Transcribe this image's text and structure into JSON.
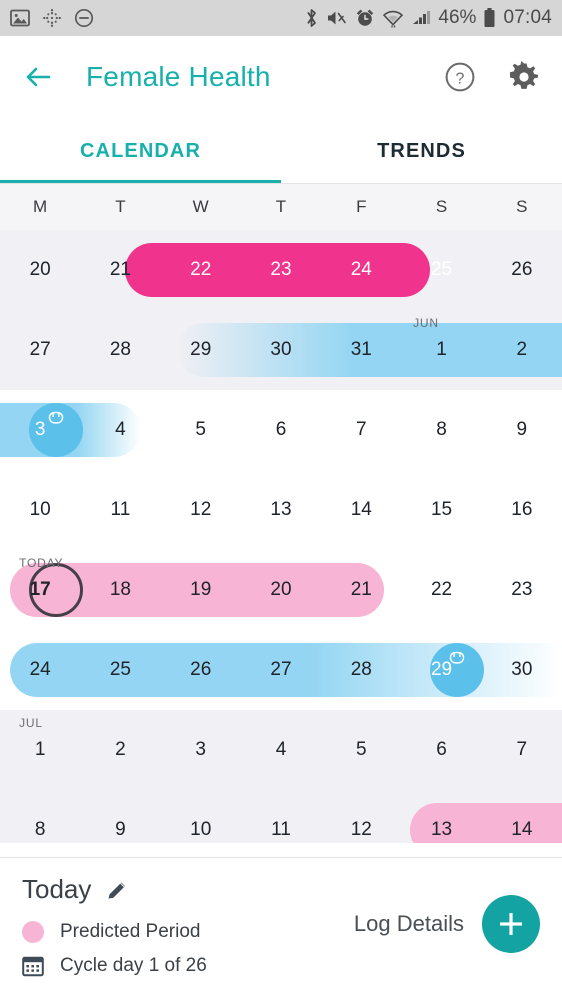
{
  "status_bar": {
    "left_icons": [
      "image-icon",
      "dots-move-icon",
      "do-not-disturb-icon"
    ],
    "right_icons": [
      "bluetooth-icon",
      "vibrate-icon",
      "alarm-icon",
      "wifi-icon",
      "signal-icon",
      "battery-icon"
    ],
    "battery_percent": "46%",
    "time": "07:04"
  },
  "app_bar": {
    "back_icon": "back-arrow-icon",
    "title": "Female Health",
    "help_icon": "help-icon",
    "settings_icon": "gear-icon"
  },
  "tabs": [
    {
      "label": "CALENDAR",
      "active": true
    },
    {
      "label": "TRENDS",
      "active": false
    }
  ],
  "weekdays": [
    "M",
    "T",
    "W",
    "T",
    "F",
    "S",
    "S"
  ],
  "calendar": {
    "weeks": [
      {
        "shade": "gray",
        "days": [
          "20",
          "21",
          "22",
          "23",
          "24",
          "25",
          "26"
        ],
        "month_label": null
      },
      {
        "shade": "gray",
        "days": [
          "27",
          "28",
          "29",
          "30",
          "31",
          "1",
          "2"
        ],
        "month_label": {
          "text": "JUN",
          "col": 5
        }
      },
      {
        "shade": "white",
        "days": [
          "3",
          "4",
          "5",
          "6",
          "7",
          "8",
          "9"
        ],
        "month_label": null
      },
      {
        "shade": "white",
        "days": [
          "10",
          "11",
          "12",
          "13",
          "14",
          "15",
          "16"
        ],
        "month_label": null
      },
      {
        "shade": "white",
        "days": [
          "17",
          "18",
          "19",
          "20",
          "21",
          "22",
          "23"
        ],
        "month_label": {
          "text": "TODAY",
          "col": 0
        }
      },
      {
        "shade": "white",
        "days": [
          "24",
          "25",
          "26",
          "27",
          "28",
          "29",
          "30"
        ],
        "month_label": null
      },
      {
        "shade": "gray",
        "days": [
          "1",
          "2",
          "3",
          "4",
          "5",
          "6",
          "7"
        ],
        "month_label": {
          "text": "JUL",
          "col": 0
        }
      },
      {
        "shade": "gray",
        "days": [
          "8",
          "9",
          "10",
          "11",
          "12",
          "13",
          "14"
        ],
        "month_label": null
      }
    ],
    "today": {
      "week": 4,
      "col": 0,
      "day": "17"
    },
    "ovulation_days": [
      {
        "week": 2,
        "col": 0,
        "day": "3"
      },
      {
        "week": 5,
        "col": 5,
        "day": "29"
      }
    ]
  },
  "bottom_panel": {
    "today_label": "Today",
    "edit_icon": "pencil-icon",
    "legend": [
      {
        "icon": "pink-dot-icon",
        "label": "Predicted Period"
      },
      {
        "icon": "calendar-icon",
        "label": "Cycle day 1 of 26"
      }
    ],
    "log_details_label": "Log Details",
    "add_icon": "plus-icon"
  },
  "colors": {
    "accent_teal": "#17b0ab",
    "period_pink": "#f0338c",
    "predicted_pink": "#f8b4d4",
    "fertile_blue": "#93d5f2",
    "ovulation_blue": "#5bc0ea",
    "fab_teal": "#14a3a3",
    "row_shade": "#f1f0f4"
  }
}
